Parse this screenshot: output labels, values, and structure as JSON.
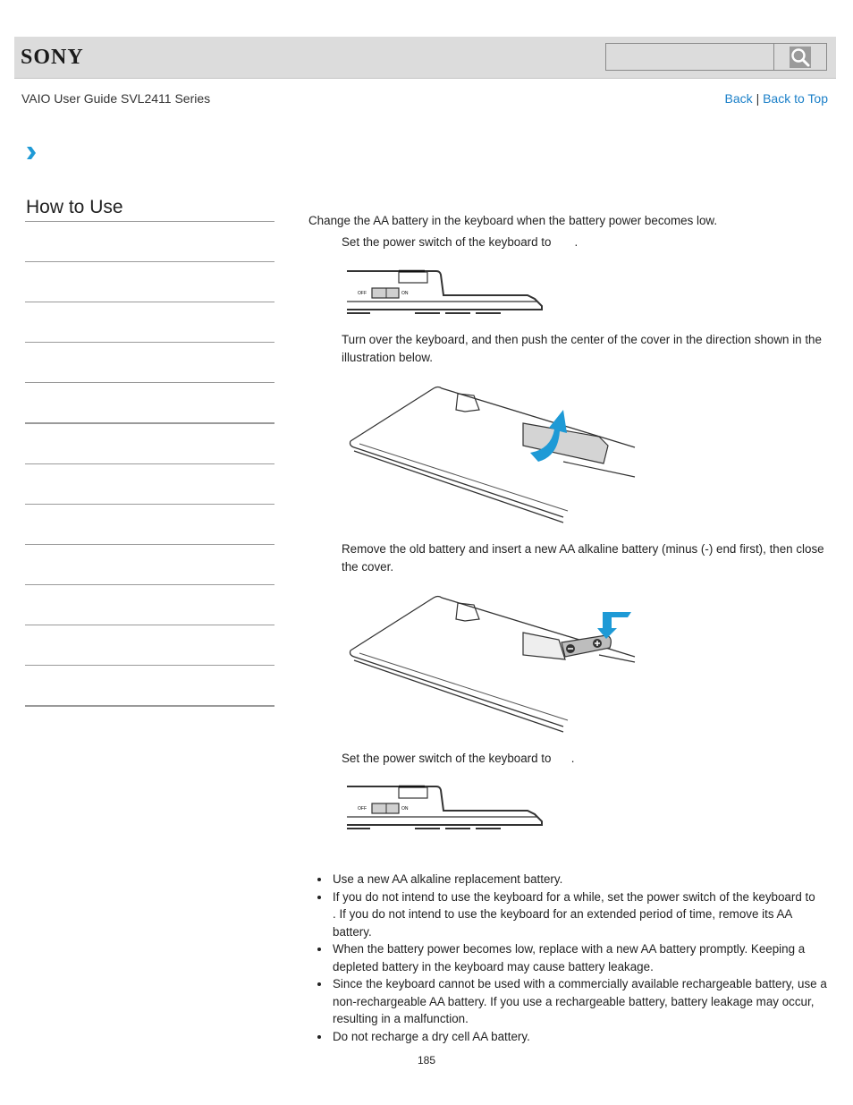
{
  "header": {
    "brand": "SONY",
    "search": {
      "placeholder": "",
      "value": "",
      "button_icon": "search-icon"
    }
  },
  "guide_title": "VAIO User Guide SVL2411 Series",
  "nav": {
    "back": "Back",
    "separator": "|",
    "back_to_top": "Back to Top"
  },
  "breadcrumb": {
    "icon": "chevron-right-icon"
  },
  "sidebar": {
    "heading": "How to Use",
    "items": [
      "",
      "",
      "",
      "",
      "",
      "",
      "",
      "",
      "",
      "",
      "",
      ""
    ]
  },
  "main": {
    "intro": "Change the AA battery in the keyboard when the battery power becomes low.",
    "steps": [
      {
        "text": "Set the power switch of the keyboard to       .",
        "illustration": "keyboard-switch-off-illustration",
        "switch_labels": [
          "OFF",
          "ON"
        ]
      },
      {
        "text": "Turn over the keyboard, and then push the center of the cover in the direction shown in the illustration below.",
        "illustration": "keyboard-open-cover-illustration"
      },
      {
        "text": "Remove the old battery and insert a new AA alkaline battery (minus (-) end first), then close the cover.",
        "illustration": "keyboard-insert-battery-illustration"
      },
      {
        "text": "Set the power switch of the keyboard to      .",
        "illustration": "keyboard-switch-on-illustration",
        "switch_labels": [
          "OFF",
          "ON"
        ]
      }
    ],
    "notes": [
      "Use a new AA alkaline replacement battery.",
      "If you do not intend to use the keyboard for a while, set the power switch of the keyboard to        . If you do not intend to use the keyboard for an extended period of time, remove its AA battery.",
      "When the battery power becomes low, replace with a new AA battery promptly. Keeping a depleted battery in the keyboard may cause battery leakage.",
      "Since the keyboard cannot be used with a commercially available rechargeable battery, use a non-rechargeable AA battery. If you use a rechargeable battery, battery leakage may occur, resulting in a malfunction.",
      "Do not recharge a dry cell AA battery."
    ]
  },
  "page_number": "185",
  "colors": {
    "link": "#1a7fc8",
    "accent_arrow": "#1e9ad6",
    "header_bg": "#dcdcdc"
  }
}
